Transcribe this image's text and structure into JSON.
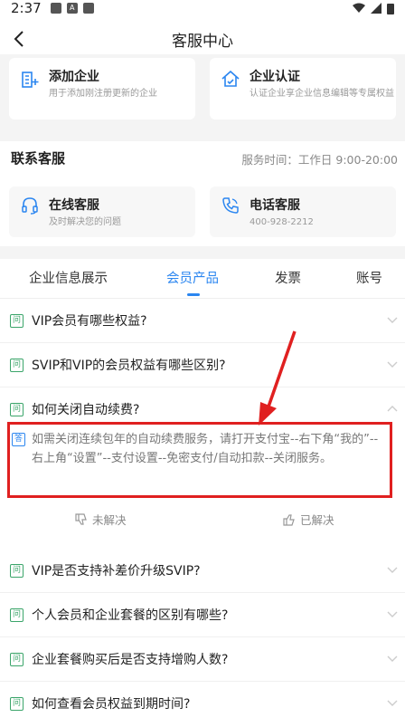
{
  "status": {
    "time": "2:37",
    "icon_a": "A"
  },
  "nav": {
    "title": "客服中心"
  },
  "top_cards": [
    {
      "title": "添加企业",
      "subtitle": "用于添加刚注册更新的企业",
      "icon": "building-add-icon"
    },
    {
      "title": "企业认证",
      "subtitle": "认证企业享企业信息编辑等专属权益",
      "icon": "house-check-icon"
    }
  ],
  "contact": {
    "title": "联系客服",
    "hours": "服务时间：工作日 9:00-20:00",
    "cards": [
      {
        "title": "在线客服",
        "subtitle": "及时解决您的问题",
        "icon": "headset-icon"
      },
      {
        "title": "电话客服",
        "subtitle": "400-928-2212",
        "icon": "phone-icon"
      }
    ]
  },
  "tabs": [
    "企业信息展示",
    "会员产品",
    "发票",
    "账号"
  ],
  "active_tab": "会员产品",
  "badges": {
    "question": "问",
    "answer": "答"
  },
  "faqs": [
    "VIP会员有哪些权益?",
    "SVIP和VIP的会员权益有哪些区别?",
    "如何关闭自动续费?",
    "VIP是否支持补差价升级SVIP?",
    "个人会员和企业套餐的区别有哪些?",
    "企业套餐购买后是否支持增购人数?",
    "如何查看会员权益到期时间?"
  ],
  "answer": "如需关闭连续包年的自动续费服务，请打开支付宝--右下角“我的”--右上角“设置”--支付设置--免密支付/自动扣款--关闭服务。",
  "feedback": {
    "unresolved": "未解决",
    "resolved": "已解决"
  },
  "colors": {
    "accent": "#2b86f0",
    "highlight": "#e02020",
    "badge_green": "#3ba56a"
  }
}
